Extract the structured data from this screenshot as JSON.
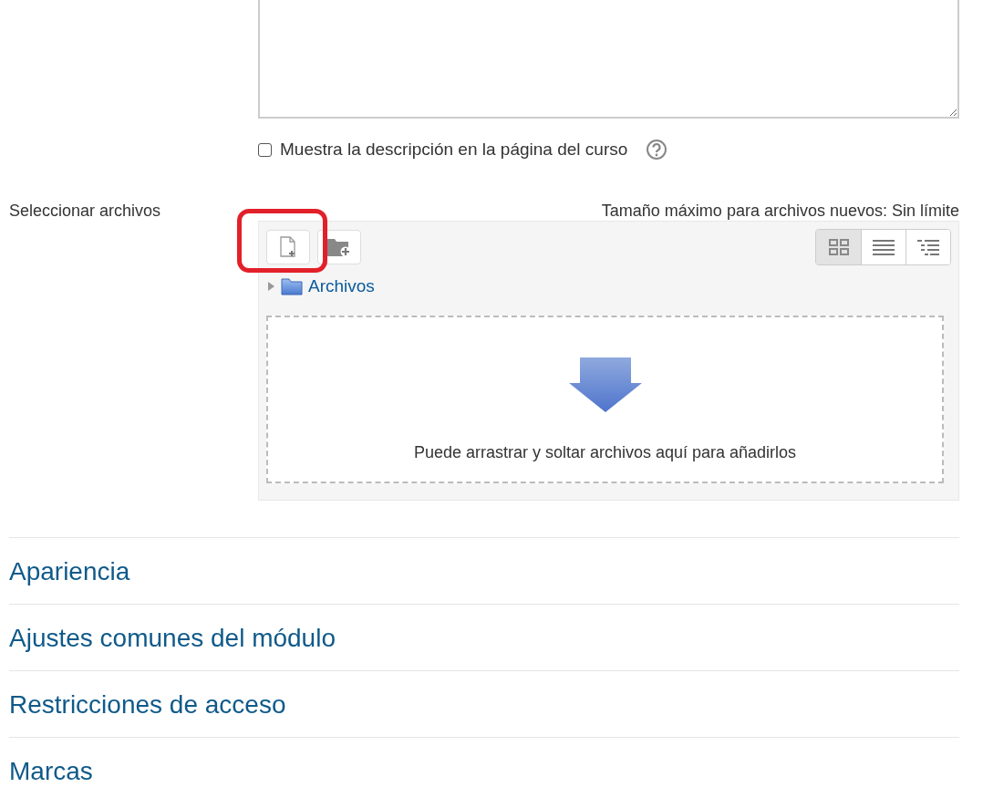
{
  "show_description": {
    "label": "Muestra la descripción en la página del curso",
    "checked": false
  },
  "files": {
    "label": "Seleccionar archivos",
    "max_size": "Tamaño máximo para archivos nuevos: Sin límite",
    "toolbar": [
      {
        "kind": "add-file",
        "highlighted": true
      },
      {
        "kind": "add-folder",
        "highlighted": false
      }
    ],
    "views": [
      {
        "kind": "icons",
        "selected": true
      },
      {
        "kind": "list",
        "selected": false
      },
      {
        "kind": "tree",
        "selected": false
      }
    ],
    "folder": {
      "name": "Archivos",
      "expanded": false
    },
    "drop_hint": "Puede arrastrar y soltar archivos aquí para añadirlos"
  },
  "sections": [
    {
      "title": "Apariencia"
    },
    {
      "title": "Ajustes comunes del módulo"
    },
    {
      "title": "Restricciones de acceso"
    },
    {
      "title": "Marcas"
    }
  ]
}
